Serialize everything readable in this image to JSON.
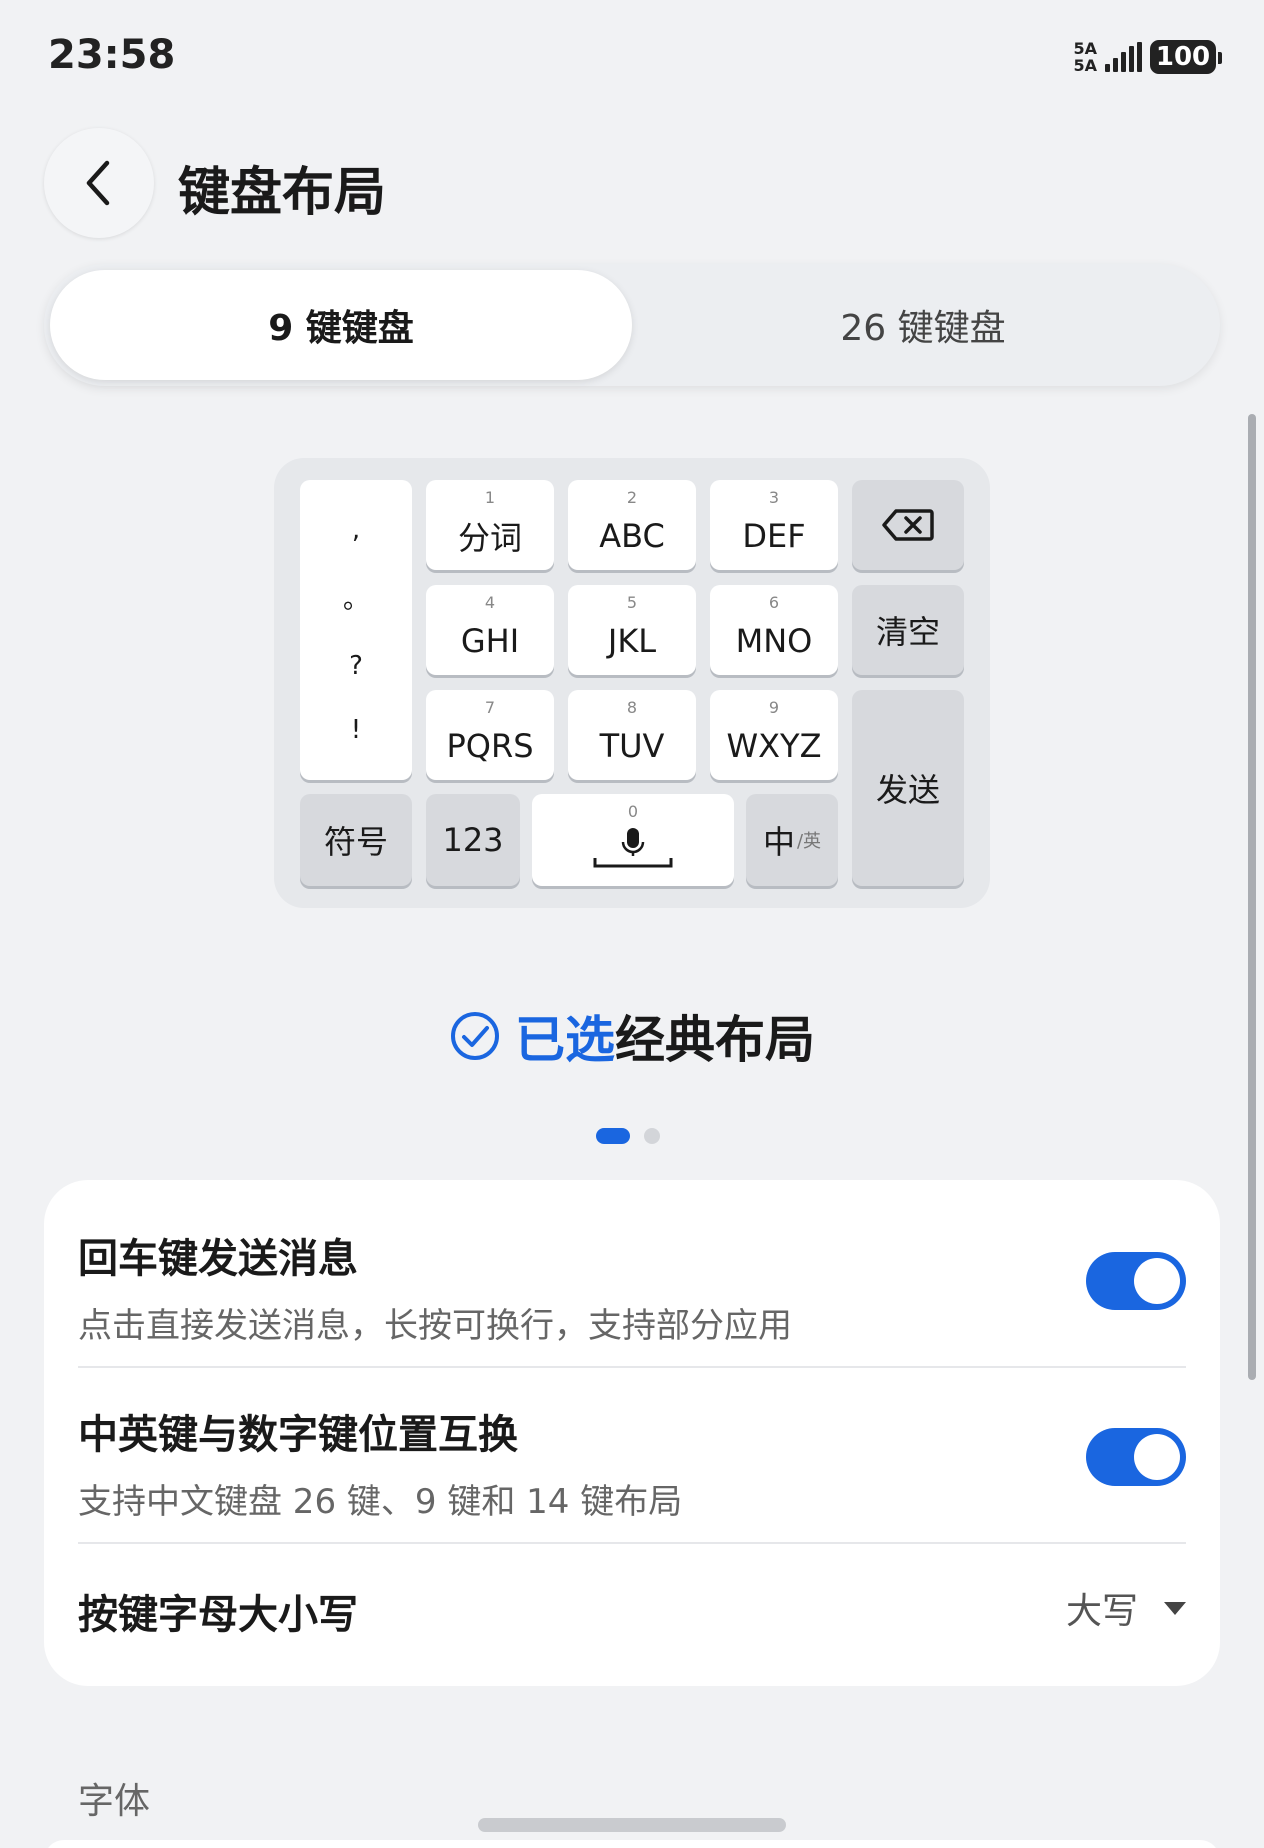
{
  "status_bar": {
    "time": "23:58",
    "network_top": "5A",
    "network_bottom": "5A",
    "battery": "100"
  },
  "header": {
    "title": "键盘布局"
  },
  "tabs": [
    {
      "label": "9 键键盘",
      "active": true
    },
    {
      "label": "26 键键盘",
      "active": false
    }
  ],
  "keyboard_preview": {
    "punctuation": [
      ",",
      "。",
      "?",
      "!"
    ],
    "keys": {
      "k1": {
        "num": "1",
        "label": "分词"
      },
      "k2": {
        "num": "2",
        "label": "ABC"
      },
      "k3": {
        "num": "3",
        "label": "DEF"
      },
      "k4": {
        "num": "4",
        "label": "GHI"
      },
      "k5": {
        "num": "5",
        "label": "JKL"
      },
      "k6": {
        "num": "6",
        "label": "MNO"
      },
      "k7": {
        "num": "7",
        "label": "PQRS"
      },
      "k8": {
        "num": "8",
        "label": "TUV"
      },
      "k9": {
        "num": "9",
        "label": "WXYZ"
      },
      "k0": {
        "num": "0"
      }
    },
    "clear": "清空",
    "send": "发送",
    "symbols": "符号",
    "numbers": "123",
    "lang_main": "中",
    "lang_sub": "/英"
  },
  "selected": {
    "label": "已选",
    "layout_name": "经典布局"
  },
  "pager": {
    "pages": 2,
    "current": 1
  },
  "settings": {
    "enter_send": {
      "title": "回车键发送消息",
      "desc": "点击直接发送消息，长按可换行，支持部分应用",
      "enabled": true
    },
    "swap_keys": {
      "title": "中英键与数字键位置互换",
      "desc": "支持中文键盘 26 键、9 键和 14 键布局",
      "enabled": true
    },
    "letter_case": {
      "title": "按键字母大小写",
      "value": "大写"
    }
  },
  "section_font": "字体",
  "colors": {
    "accent": "#1a66e0",
    "background": "#f1f2f4"
  }
}
